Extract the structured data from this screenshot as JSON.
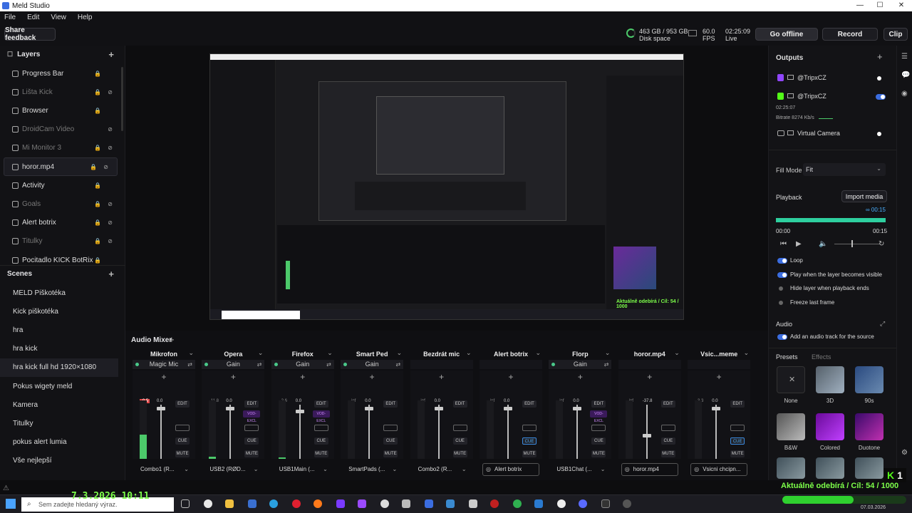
{
  "window": {
    "title": "Meld Studio",
    "controls": [
      "—",
      "☐",
      "✕"
    ]
  },
  "menu": [
    "File",
    "Edit",
    "View",
    "Help"
  ],
  "toolbar": {
    "share_feedback": "Share feedback",
    "disk": "463 GB / 953 GB",
    "disk_label": "Disk space",
    "fps_value": "60.0",
    "fps_label": "FPS",
    "time": "02:25:09",
    "live_label": "Live",
    "go_offline": "Go offline",
    "record": "Record",
    "clip": "Clip"
  },
  "layers": {
    "title": "Layers",
    "items": [
      {
        "label": "Progress Bar",
        "dim": false,
        "lock": true,
        "eye": false
      },
      {
        "label": "Lišta Kick",
        "dim": true,
        "lock": true,
        "eye": true
      },
      {
        "label": "Browser",
        "dim": false,
        "lock": true,
        "eye": false
      },
      {
        "label": "DroidCam Video",
        "dim": true,
        "lock": false,
        "eye": true
      },
      {
        "label": "Mi Monitor 3",
        "dim": true,
        "lock": true,
        "eye": true
      },
      {
        "label": "horor.mp4",
        "dim": false,
        "lock": true,
        "eye": true,
        "selected": true
      },
      {
        "label": "Activity",
        "dim": false,
        "lock": true,
        "eye": false
      },
      {
        "label": "Goals",
        "dim": true,
        "lock": true,
        "eye": true
      },
      {
        "label": "Alert botrix",
        "dim": false,
        "lock": true,
        "eye": true
      },
      {
        "label": "Titulky",
        "dim": true,
        "lock": true,
        "eye": true
      },
      {
        "label": "Pocitadlo KICK BotRix",
        "dim": false,
        "lock": true,
        "eye": false
      }
    ]
  },
  "scenes": {
    "title": "Scenes",
    "items": [
      "MELD Piškotéka",
      "Kick piškotéka",
      "hra",
      "hra kick",
      "hra kick full hd 1920×1080",
      "Pokus wigety meld",
      "Kamera",
      "Titulky",
      "pokus alert lumia",
      "Vše nejlepší"
    ],
    "selected_index": 4
  },
  "mixer": {
    "title": "Audio Mixer",
    "channels": [
      {
        "name": "Mikrofon",
        "filter": "Magic Mic",
        "level": "-0.5",
        "gain": "0.0",
        "device": "Combo1 (R...",
        "meter": 0.42,
        "fader": 0.96,
        "dot": true,
        "vod": false,
        "cue_active": false,
        "device_icon": false
      },
      {
        "name": "Opera",
        "filter": "Gain",
        "level": "-11.8",
        "gain": "0.0",
        "device": "USB2 (RØD...",
        "meter": 0.04,
        "fader": 0.96,
        "dot": true,
        "vod": true,
        "cue_active": false,
        "device_icon": false
      },
      {
        "name": "Firefox",
        "filter": "Gain",
        "level": "-2.6",
        "gain": "0.0",
        "device": "USB1Main (...",
        "meter": 0.03,
        "fader": 0.9,
        "dot": true,
        "vod": true,
        "cue_active": false,
        "device_icon": false
      },
      {
        "name": "Smart Ped",
        "filter": "Gain",
        "level": "-inf",
        "gain": "0.0",
        "device": "SmartPads (...",
        "meter": 0.0,
        "fader": 0.96,
        "dot": true,
        "vod": false,
        "cue_active": false,
        "device_icon": false
      },
      {
        "name": "Bezdrát mic",
        "filter": "",
        "level": "-inf",
        "gain": "0.0",
        "device": "Combo2 (R...",
        "meter": 0.0,
        "fader": 0.96,
        "dot": false,
        "vod": false,
        "cue_active": false,
        "device_icon": false
      },
      {
        "name": "Alert botrix",
        "filter": "",
        "level": "-inf",
        "gain": "0.0",
        "device": "Alert botrix",
        "meter": 0.0,
        "fader": 0.96,
        "dot": false,
        "vod": false,
        "cue_active": true,
        "device_icon": true
      },
      {
        "name": "Florp",
        "filter": "Gain",
        "level": "-inf",
        "gain": "0.0",
        "device": "USB1Chat (...",
        "meter": 0.0,
        "fader": 0.96,
        "dot": true,
        "vod": true,
        "cue_active": false,
        "device_icon": false
      },
      {
        "name": "horor.mp4",
        "filter": "",
        "level": "-inf",
        "gain": "-37.8",
        "device": "horor.mp4",
        "meter": 0.0,
        "fader": 0.42,
        "dot": false,
        "vod": false,
        "cue_active": false,
        "device_icon": true
      },
      {
        "name": "Vsic...meme",
        "filter": "",
        "level": "-3.3",
        "gain": "0.0",
        "device": "Vsicni chcipn...",
        "meter": 0.0,
        "fader": 0.96,
        "dot": false,
        "vod": false,
        "cue_active": true,
        "device_icon": true
      }
    ],
    "btn_edit": "EDIT",
    "btn_cue": "CUE",
    "btn_mute": "MUTE",
    "vod_label": "VOD-EXCL"
  },
  "outputs": {
    "title": "Outputs",
    "items": [
      {
        "label": "@TripxCZ",
        "color": "#9146ff"
      },
      {
        "label": "@TripxCZ",
        "color": "#53fc18"
      }
    ],
    "elapsed": "02:25:07",
    "bitrate": "Bitrate  8274 Kb/s",
    "virtual_camera": "Virtual Camera"
  },
  "inspector": {
    "fill_mode_label": "Fill Mode",
    "fill_mode_value": "Fit",
    "playback_label": "Playback",
    "import_media": "Import media",
    "duration_badge": "∞ 00:15",
    "time_start": "00:00",
    "time_end": "00:15",
    "progress": 1.0,
    "options": [
      {
        "label": "Loop",
        "on": true
      },
      {
        "label": "Play when the layer becomes visible",
        "on": true
      },
      {
        "label": "Hide layer when playback ends",
        "on": false
      },
      {
        "label": "Freeze last frame",
        "on": false
      }
    ],
    "audio_label": "Audio",
    "audio_option": "Add an audio track for the source",
    "tabs": [
      "Presets",
      "Effects"
    ],
    "presets": [
      "None",
      "3D",
      "90s",
      "B&W",
      "Colored",
      "Duotone"
    ]
  },
  "taskbar": {
    "search_placeholder": "Sem zadejte hledaný výraz.",
    "date": "07.03.2026"
  },
  "overlay": {
    "timestamp": "7.3.2026 10:11",
    "subs": "Aktuálně odebírá / Cíl: 54 / 1000",
    "kick_count": "1"
  },
  "colors": {
    "accent": "#3b6de0",
    "green": "#4cc96a",
    "kick": "#53fc18",
    "twitch": "#9146ff",
    "red": "#e04848"
  }
}
